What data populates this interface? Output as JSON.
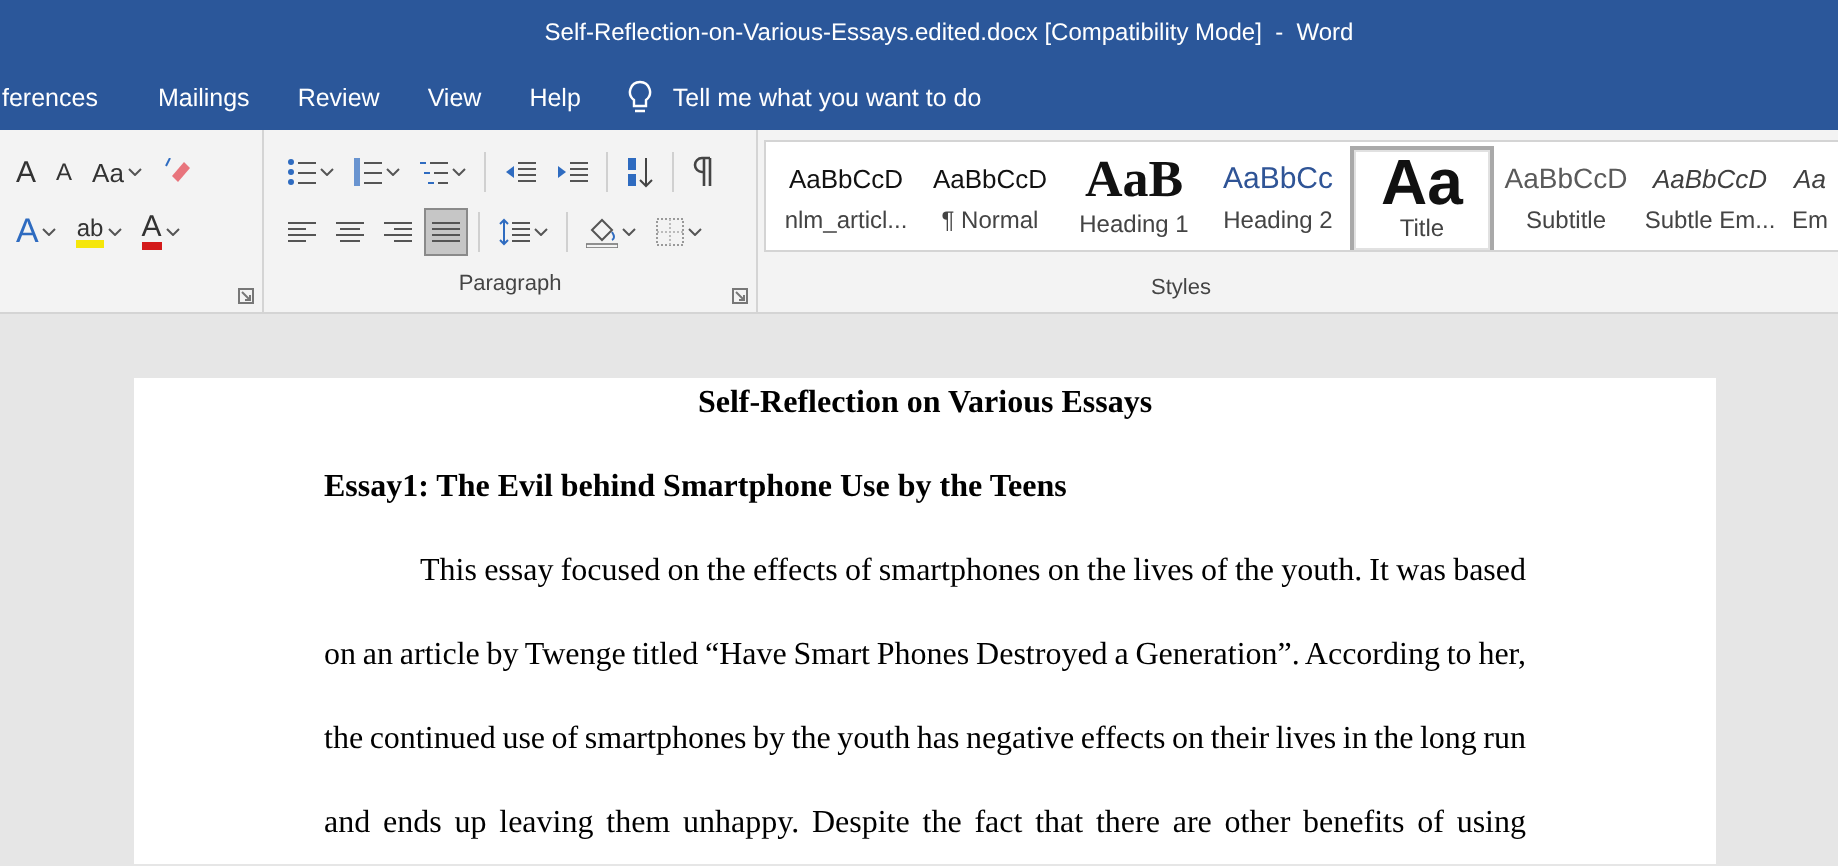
{
  "window": {
    "title": "Self-Reflection-on-Various-Essays.edited.docx [Compatibility Mode]  -  Word"
  },
  "tabs": [
    {
      "label": "ferences"
    },
    {
      "label": "Mailings"
    },
    {
      "label": "Review"
    },
    {
      "label": "View"
    },
    {
      "label": "Help"
    }
  ],
  "tell_me": {
    "placeholder": "Tell me what you want to do"
  },
  "font_group": {
    "grow_font": "A",
    "shrink_font": "A",
    "change_case": "Aa",
    "text_effects": "A",
    "highlight": "ab",
    "font_color": "A"
  },
  "paragraph_group": {
    "label": "Paragraph",
    "alignment": [
      {
        "selected": false
      },
      {
        "selected": false
      },
      {
        "selected": false
      },
      {
        "selected": true
      }
    ]
  },
  "styles_group": {
    "label": "Styles",
    "items": [
      {
        "preview": "AaBbCcD",
        "name": "nlm_articl...",
        "kind": "normal",
        "selected": false
      },
      {
        "preview": "AaBbCcD",
        "name": "¶ Normal",
        "kind": "normal",
        "selected": false
      },
      {
        "preview": "AaB",
        "name": "Heading 1",
        "kind": "heading1",
        "selected": false
      },
      {
        "preview": "AaBbCc",
        "name": "Heading 2",
        "kind": "heading2",
        "selected": false
      },
      {
        "preview": "Aa",
        "name": "Title",
        "kind": "title",
        "selected": true
      },
      {
        "preview": "AaBbCcD",
        "name": "Subtitle",
        "kind": "subtitle",
        "selected": false
      },
      {
        "preview": "AaBbCcD",
        "name": "Subtle Em...",
        "kind": "emphasis",
        "selected": false
      },
      {
        "preview": "Aa",
        "name": "Em",
        "kind": "emphasis",
        "selected": false
      }
    ]
  },
  "document": {
    "title": "Self-Reflection on Various Essays",
    "heading": "Essay1: The Evil behind Smartphone Use by the Teens",
    "paragraph": "This essay focused on the effects of smartphones on the lives of the youth. It was based on an article by Twenge titled “Have Smart Phones Destroyed a Generation”. According to her, the continued use of smartphones by the youth has negative effects on their lives in the long run and ends up leaving them unhappy. Despite the fact that there are other benefits of using"
  }
}
